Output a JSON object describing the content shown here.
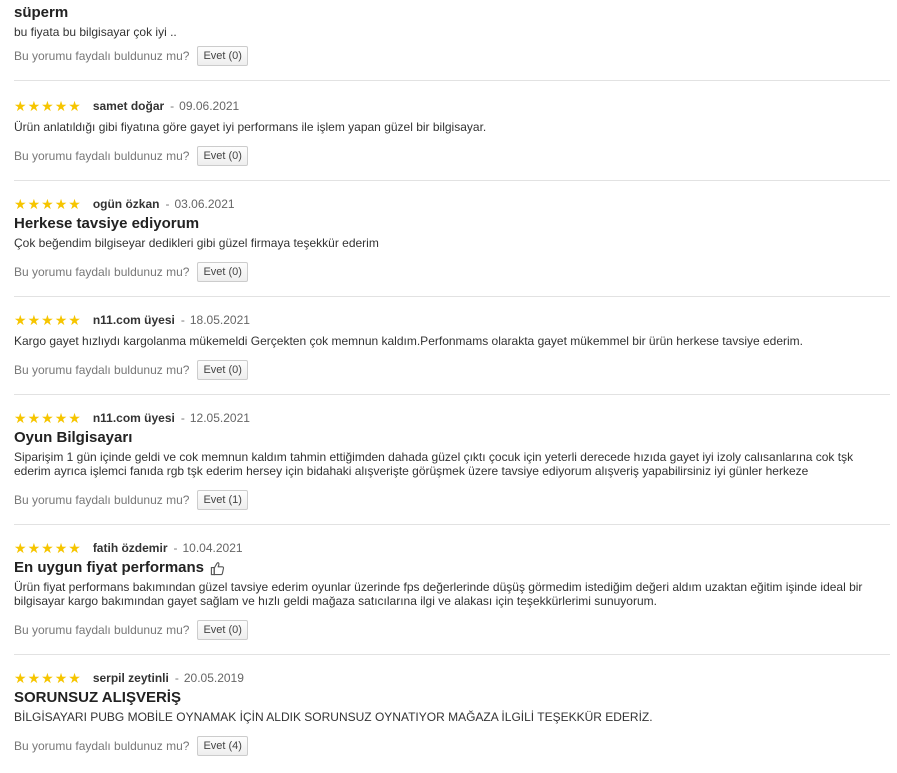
{
  "helpful_prompt": "Bu yorumu faydalı buldunuz mu?",
  "vote_label": "Evet",
  "star_color": "#f6c500",
  "reviews": [
    {
      "title": "süperm",
      "text": "bu fiyata bu bilgisayar çok iyi ..",
      "votes": "(0)"
    },
    {
      "rating": 5,
      "author": "samet doğar",
      "separator": "-",
      "date": "09.06.2021",
      "title": "",
      "text": "Ürün anlatıldığı gibi fiyatına göre gayet iyi performans ile işlem yapan güzel bir bilgisayar.",
      "votes": "(0)"
    },
    {
      "rating": 5,
      "author": "ogün özkan",
      "separator": "-",
      "date": "03.06.2021",
      "title": "Herkese tavsiye ediyorum",
      "text": "Çok beğendim bilgiseyar dedikleri gibi güzel firmaya teşekkür ederim",
      "votes": "(0)"
    },
    {
      "rating": 5,
      "author": "n11.com üyesi",
      "separator": "-",
      "date": "18.05.2021",
      "title": "",
      "text": "Kargo gayet hızlıydı kargolanma mükemeldi Gerçekten çok memnun kaldım.Perfonmams olarakta gayet mükemmel bir ürün herkese tavsiye ederim.",
      "votes": "(0)"
    },
    {
      "rating": 5,
      "author": "n11.com üyesi",
      "separator": "-",
      "date": "12.05.2021",
      "title": "Oyun Bilgisayarı",
      "text": "Siparişim 1 gün içinde geldi ve cok memnun kaldım tahmin ettiğimden dahada güzel çıktı çocuk için yeterli derecede hızıda gayet iyi izoly calısanlarına cok tşk ederim ayrıca işlemci fanıda rgb tşk ederim hersey için bidahaki alışverişte görüşmek üzere tavsiye ediyorum alışveriş yapabilirsiniz iyi günler herkeze",
      "votes": "(1)"
    },
    {
      "rating": 5,
      "author": "fatih özdemir",
      "separator": "-",
      "date": "10.04.2021",
      "title": "En uygun fiyat performans",
      "title_icon": "thumbs-up-icon",
      "text": "Ürün fiyat performans bakımından güzel tavsiye ederim oyunlar üzerinde fps değerlerinde düşüş görmedim istediğim değeri aldım uzaktan eğitim işinde ideal bir bilgisayar kargo bakımından gayet sağlam ve hızlı geldi mağaza satıcılarına ilgi ve alakası için teşekkürlerimi sunuyorum.",
      "votes": "(0)"
    },
    {
      "rating": 5,
      "author": "serpil zeytinli",
      "separator": "-",
      "date": "20.05.2019",
      "title": "SORUNSUZ ALIŞVERİŞ",
      "text": "BİLGİSAYARI PUBG MOBİLE OYNAMAK İÇİN ALDIK SORUNSUZ OYNATIYOR MAĞAZA İLGİLİ TEŞEKKÜR EDERİZ.",
      "votes": "(4)"
    }
  ]
}
